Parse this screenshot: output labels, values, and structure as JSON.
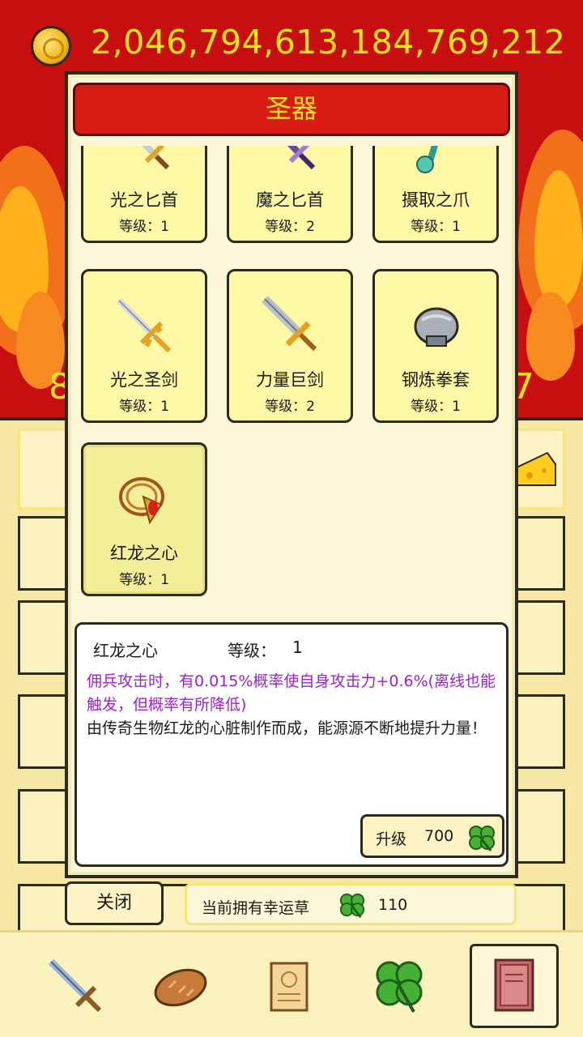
{
  "header": {
    "gold_amount": "2,046,794,613,184,769,212",
    "coin_icon": "gold-coin-icon"
  },
  "background": {
    "left_digit": "8",
    "right_digit": "7"
  },
  "modal": {
    "title": "圣器",
    "items": [
      {
        "name": "光之匕首",
        "level": "等级：1",
        "icon": "light-dagger-icon"
      },
      {
        "name": "魔之匕首",
        "level": "等级：2",
        "icon": "magic-dagger-icon"
      },
      {
        "name": "摄取之爪",
        "level": "等级：1",
        "icon": "absorb-claw-icon"
      },
      {
        "name": "光之圣剑",
        "level": "等级：1",
        "icon": "holy-sword-icon"
      },
      {
        "name": "力量巨剑",
        "level": "等级：2",
        "icon": "power-greatsword-icon"
      },
      {
        "name": "钢炼拳套",
        "level": "等级：1",
        "icon": "steel-gauntlet-icon"
      },
      {
        "name": "红龙之心",
        "level": "等级：1",
        "icon": "red-dragon-heart-icon",
        "selected": true
      }
    ],
    "detail": {
      "name": "红龙之心",
      "level_label": "等级：",
      "level_value": "1",
      "effect": "佣兵攻击时，有0.015%概率使自身攻击力+0.6%(离线也能触发，但概率有所降低)",
      "lore": "由传奇生物红龙的心脏制作而成，能源源不断地提升力量！",
      "upgrade_label": "升级",
      "upgrade_cost": "700"
    }
  },
  "footer": {
    "close_label": "关闭",
    "luck_label": "当前拥有幸运草",
    "luck_count": "110"
  },
  "tabs": [
    {
      "icon": "sword-icon",
      "active": false
    },
    {
      "icon": "bread-icon",
      "active": false
    },
    {
      "icon": "scroll-icon",
      "active": false
    },
    {
      "icon": "clover-icon",
      "active": false
    },
    {
      "icon": "book-icon",
      "active": true
    }
  ],
  "colors": {
    "background_red": "#c80f0f",
    "title_red": "#d81c14",
    "gold_text": "#ffe31a",
    "card_yellow": "#fdf7a6",
    "effect_purple": "#9b22c8"
  }
}
